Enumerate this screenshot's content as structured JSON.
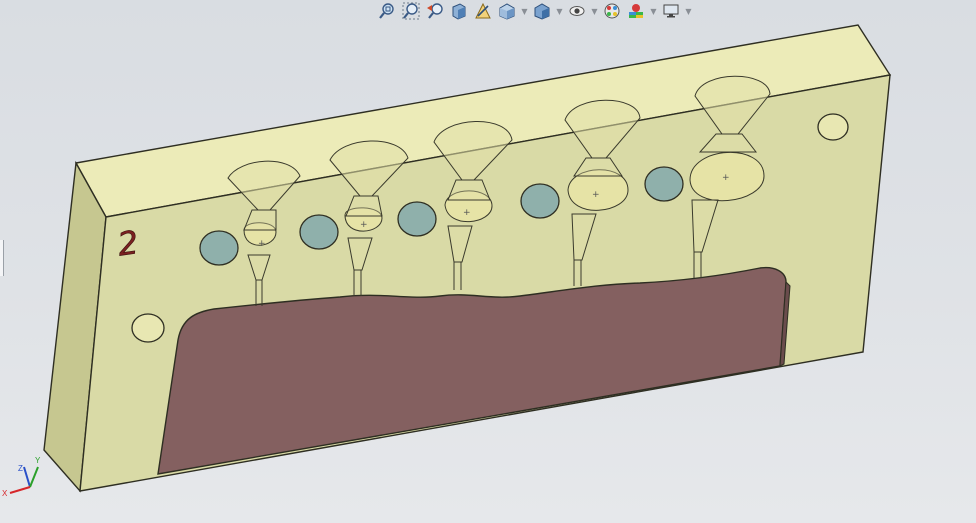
{
  "toolbar": {
    "tools": [
      {
        "name": "zoom-to-fit-icon",
        "dropdown": false
      },
      {
        "name": "zoom-to-area-icon",
        "dropdown": false
      },
      {
        "name": "previous-view-icon",
        "dropdown": false
      },
      {
        "name": "section-view-icon",
        "dropdown": false
      },
      {
        "name": "dynamic-annotation-view-icon",
        "dropdown": false
      },
      {
        "name": "view-orientation-icon",
        "dropdown": true
      },
      {
        "name": "display-style-icon",
        "dropdown": true
      },
      {
        "name": "hide-show-items-icon",
        "dropdown": true
      },
      {
        "name": "edit-appearance-icon",
        "dropdown": false
      },
      {
        "name": "apply-scene-icon",
        "dropdown": true
      },
      {
        "name": "view-settings-icon",
        "dropdown": true
      }
    ]
  },
  "model": {
    "part_label": "2",
    "colors": {
      "body_top": "#ecebb8",
      "body_front": "#d8d9a4",
      "body_side": "#c9ca92",
      "cavity": "#846060",
      "hole_teal": "#8fb0ab",
      "edge": "#2e2e22"
    }
  },
  "triad": {
    "x_label": "X",
    "y_label": "Y",
    "z_label": "Z",
    "x_color": "#d6262a",
    "y_color": "#2aa02a",
    "z_color": "#2950c8"
  }
}
